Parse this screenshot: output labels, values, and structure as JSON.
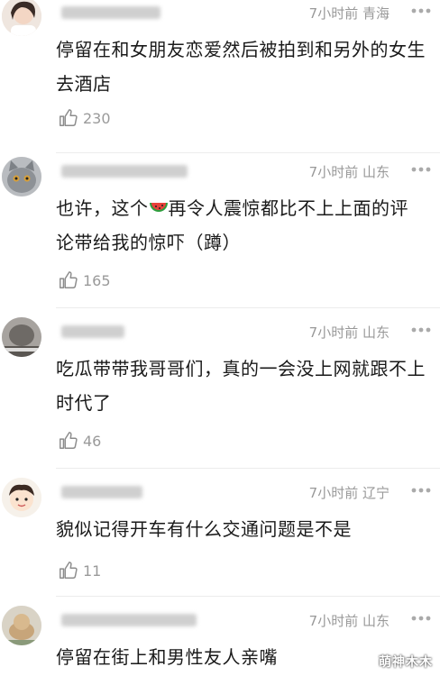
{
  "comments": [
    {
      "user": "",
      "time": "7小时前",
      "location": "青海",
      "text": "停留在和女朋友恋爱然后被拍到和另外的女生去酒店",
      "likes": "230",
      "avatar_icon": "girl-portrait-avatar"
    },
    {
      "user": "",
      "time": "7小时前",
      "location": "山东",
      "text_before": "也许，这个",
      "text_after": "再令人震惊都比不上上面的评论带给我的惊吓（蹲）",
      "emoji": "watermelon-emoji",
      "likes": "165",
      "avatar_icon": "gray-cat-avatar"
    },
    {
      "user": "",
      "time": "7小时前",
      "location": "山东",
      "text": "吃瓜带带我哥哥们，真的一会没上网就跟不上时代了",
      "likes": "46",
      "avatar_icon": "cat-meme-avatar"
    },
    {
      "user": "",
      "time": "7小时前",
      "location": "辽宁",
      "text": "貌似记得开车有什么交通问题是不是",
      "likes": "11",
      "avatar_icon": "cartoon-boy-avatar"
    },
    {
      "user": "",
      "time": "7小时前",
      "location": "山东",
      "text": "停留在街上和男性友人亲嘴",
      "avatar_icon": "dog-avatar"
    }
  ],
  "watermark": "萌神木木",
  "colors": {
    "meta": "#999999",
    "text": "#1a1a1a",
    "divider": "#ececec"
  }
}
